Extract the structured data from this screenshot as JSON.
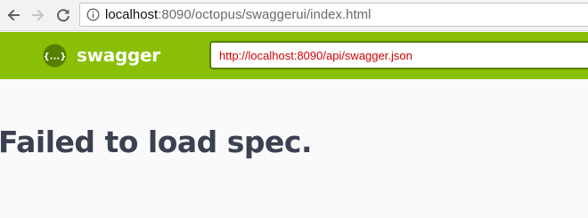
{
  "browser": {
    "url_host": "localhost",
    "url_rest": ":8090/octopus/swaggerui/index.html"
  },
  "topbar": {
    "logo_text": "swagger",
    "logo_icon_glyph": "{...}",
    "spec_url_value": "http://localhost:8090/api/swagger.json",
    "colors": {
      "bar": "#89bf04",
      "input_border": "#547f00",
      "input_text": "#d40000"
    }
  },
  "main": {
    "error_message": "Failed to load spec."
  },
  "icons": {
    "back": "arrow-left-icon",
    "forward": "arrow-right-icon",
    "reload": "reload-icon",
    "info": "info-icon",
    "logo": "swagger-logo-icon"
  }
}
